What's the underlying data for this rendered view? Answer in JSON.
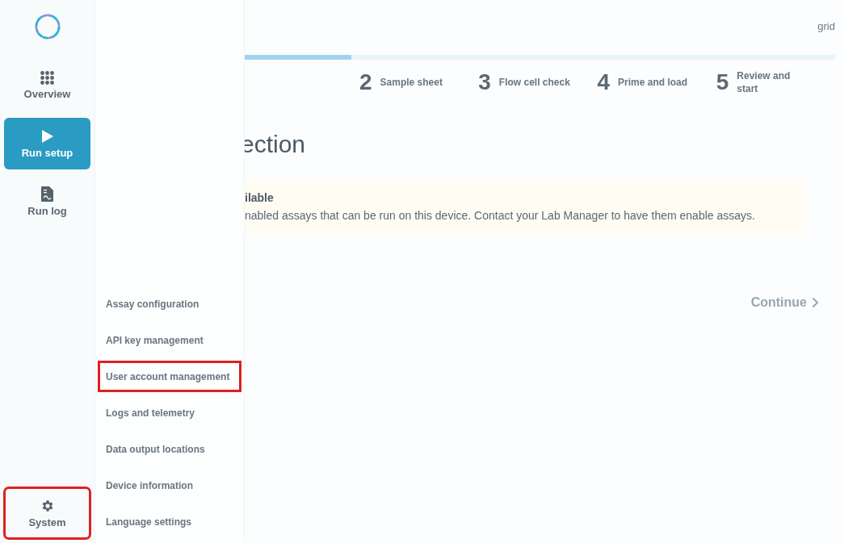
{
  "nav": {
    "items": [
      {
        "label": "Overview",
        "kind": "grid",
        "selected": false,
        "highlighted": false
      },
      {
        "label": "Run setup",
        "kind": "play",
        "selected": true,
        "highlighted": false
      },
      {
        "label": "Run log",
        "kind": "log",
        "selected": false,
        "highlighted": false
      }
    ],
    "bottom": {
      "label": "System",
      "kind": "gear",
      "selected": false,
      "highlighted": true
    }
  },
  "system_menu": [
    {
      "label": "Assay configuration",
      "highlighted": false
    },
    {
      "label": "API key management",
      "highlighted": false
    },
    {
      "label": "User account management",
      "highlighted": true
    },
    {
      "label": "Logs and telemetry",
      "highlighted": false
    },
    {
      "label": "Data output locations",
      "highlighted": false
    },
    {
      "label": "Device information",
      "highlighted": false
    },
    {
      "label": "Language settings",
      "highlighted": false
    }
  ],
  "header": {
    "user": "grid"
  },
  "progress": {
    "level": 0.18
  },
  "steps": [
    {
      "number": "2",
      "label": "Sample sheet"
    },
    {
      "number": "3",
      "label": "Flow cell check"
    },
    {
      "number": "4",
      "label": "Prime and load"
    },
    {
      "number": "5",
      "label": "Review and start"
    }
  ],
  "title": "ection",
  "notice": {
    "heading": "ilable",
    "text": "nabled assays that can be run on this device. Contact your Lab Manager to have them enable assays."
  },
  "continue_button": {
    "label": "Continue",
    "disabled": true
  }
}
